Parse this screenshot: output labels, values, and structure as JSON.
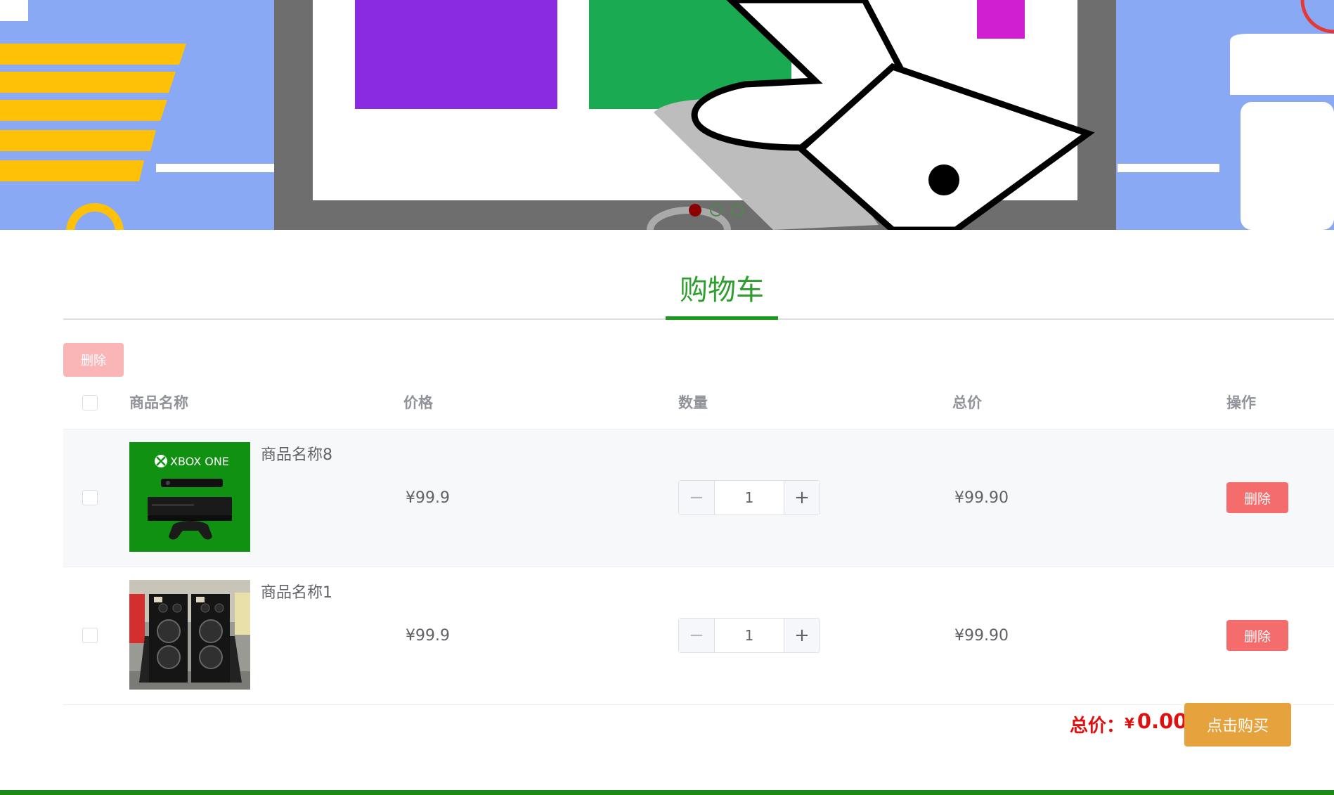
{
  "carousel": {
    "active_index": 0,
    "dot_count": 3
  },
  "cart": {
    "title": "购物车",
    "batch_delete_label": "删除",
    "columns": {
      "name": "商品名称",
      "price": "价格",
      "quantity": "数量",
      "subtotal": "总价",
      "action": "操作"
    },
    "items": [
      {
        "name": "商品名称8",
        "image": "xbox-one-console-image",
        "image_text": "XBOX ONE",
        "price": "¥99.9",
        "quantity": "1",
        "subtotal": "¥99.90",
        "delete_label": "删除",
        "checked": false
      },
      {
        "name": "商品名称1",
        "image": "speakers-image",
        "price": "¥99.9",
        "quantity": "1",
        "subtotal": "¥99.90",
        "delete_label": "删除",
        "checked": false
      }
    ],
    "total_label": "总价：",
    "total_currency": "¥",
    "total_value": "0.00",
    "buy_label": "点击购买"
  },
  "colors": {
    "brand_green": "#2e9f2e",
    "danger": "#f56c6c",
    "danger_disabled": "#fab6b6",
    "warning": "#e6a23c",
    "total_red": "#e01010"
  }
}
